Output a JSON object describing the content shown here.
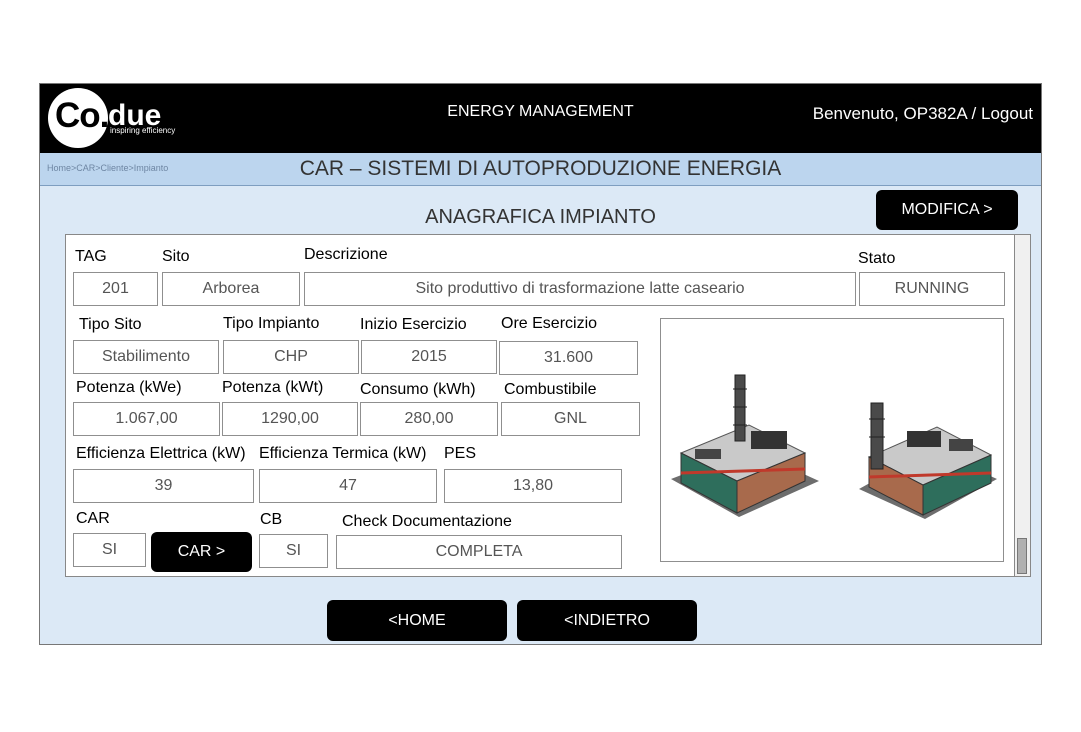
{
  "brand": {
    "logo_co": "Co.",
    "logo_due": "due",
    "tagline": "inspiring efficiency"
  },
  "header": {
    "title": "ENERGY MANAGEMENT",
    "user_greeting": "Benvenuto, OP382A / Logout"
  },
  "breadcrumb": "Home>CAR>Cliente>Impianto",
  "page_title": "CAR – SISTEMI DI AUTOPRODUZIONE ENERGIA",
  "section_title": "ANAGRAFICA IMPIANTO",
  "buttons": {
    "modifica": "MODIFICA >",
    "car": "CAR >",
    "home": "<HOME",
    "back": "<INDIETRO"
  },
  "fields": {
    "tag": {
      "label": "TAG",
      "value": "201"
    },
    "sito": {
      "label": "Sito",
      "value": "Arborea"
    },
    "descrizione": {
      "label": "Descrizione",
      "value": "Sito produttivo di trasformazione latte caseario"
    },
    "stato": {
      "label": "Stato",
      "value": "RUNNING"
    },
    "tipo_sito": {
      "label": "Tipo Sito",
      "value": "Stabilimento"
    },
    "tipo_impianto": {
      "label": "Tipo Impianto",
      "value": "CHP"
    },
    "inizio": {
      "label": "Inizio Esercizio",
      "value": "2015"
    },
    "ore": {
      "label": "Ore Esercizio",
      "value": "31.600"
    },
    "potenza_kwe": {
      "label": "Potenza (kWe)",
      "value": "1.067,00"
    },
    "potenza_kwt": {
      "label": "Potenza (kWt)",
      "value": "1290,00"
    },
    "consumo": {
      "label": "Consumo (kWh)",
      "value": "280,00"
    },
    "combustibile": {
      "label": "Combustibile",
      "value": "GNL"
    },
    "eff_el": {
      "label": "Efficienza Elettrica (kW)",
      "value": "39"
    },
    "eff_term": {
      "label": "Efficienza Termica (kW)",
      "value": "47"
    },
    "pes": {
      "label": "PES",
      "value": "13,80"
    },
    "car": {
      "label": "CAR",
      "value": "SI"
    },
    "cb": {
      "label": "CB",
      "value": "SI"
    },
    "check_doc": {
      "label": "Check Documentazione",
      "value": "COMPLETA"
    }
  },
  "colors": {
    "background": "#dce9f6",
    "subbar": "#bcd5ee",
    "header": "#000000",
    "button": "#000000"
  },
  "icons": {
    "plant": "chp-plant-illustration"
  }
}
